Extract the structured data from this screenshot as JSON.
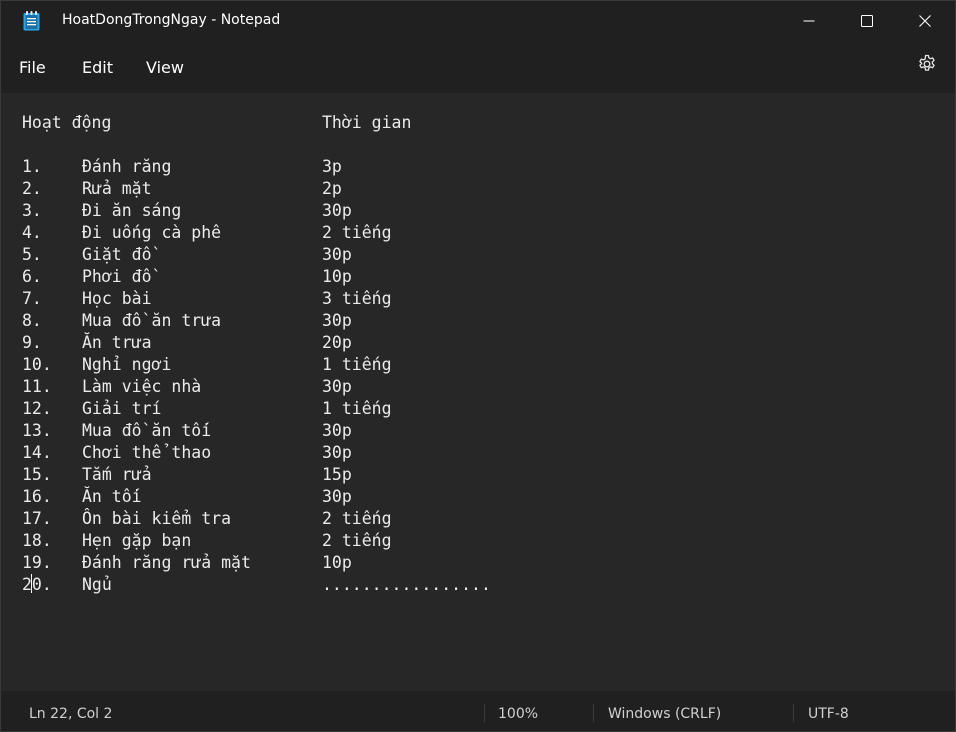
{
  "window": {
    "title": "HoatDongTrongNgay - Notepad"
  },
  "titlebar_controls": {
    "minimize_icon": "minimize-icon",
    "maximize_icon": "maximize-icon",
    "close_icon": "close-icon"
  },
  "menu": {
    "file": "File",
    "edit": "Edit",
    "view": "View",
    "settings_icon": "gear-icon"
  },
  "document": {
    "header": {
      "activity": "Hoạt động",
      "time": "Thời gian"
    },
    "rows": [
      {
        "num": "1.",
        "activity": "Đánh răng",
        "time": "3p"
      },
      {
        "num": "2.",
        "activity": "Rửa mặt",
        "time": "2p"
      },
      {
        "num": "3.",
        "activity": "Đi ăn sáng",
        "time": "30p"
      },
      {
        "num": "4.",
        "activity": "Đi uống cà phê",
        "time": "2 tiếng"
      },
      {
        "num": "5.",
        "activity": "Giặt đồ",
        "time": "30p"
      },
      {
        "num": "6.",
        "activity": "Phơi đồ",
        "time": "10p"
      },
      {
        "num": "7.",
        "activity": "Học bài",
        "time": "3 tiếng"
      },
      {
        "num": "8.",
        "activity": "Mua đồ ăn trưa",
        "time": "30p"
      },
      {
        "num": "9.",
        "activity": "Ăn trưa",
        "time": "20p"
      },
      {
        "num": "10.",
        "activity": "Nghỉ ngơi",
        "time": "1 tiếng"
      },
      {
        "num": "11.",
        "activity": "Làm việc nhà",
        "time": "30p"
      },
      {
        "num": "12.",
        "activity": "Giải trí",
        "time": "1 tiếng"
      },
      {
        "num": "13.",
        "activity": "Mua đồ ăn tối",
        "time": "30p"
      },
      {
        "num": "14.",
        "activity": "Chơi thể thao",
        "time": "30p"
      },
      {
        "num": "15.",
        "activity": "Tắm rửa",
        "time": "15p"
      },
      {
        "num": "16.",
        "activity": "Ăn tối",
        "time": "30p"
      },
      {
        "num": "17.",
        "activity": "Ôn bài kiểm tra",
        "time": "2 tiếng"
      },
      {
        "num": "18.",
        "activity": "Hẹn gặp bạn",
        "time": "2 tiếng"
      },
      {
        "num": "19.",
        "activity": "Đánh răng rửa mặt",
        "time": "10p"
      },
      {
        "num": "20.",
        "activity": "Ngủ",
        "time": "................."
      }
    ]
  },
  "statusbar": {
    "position": "Ln 22, Col 2",
    "zoom": "100%",
    "line_ending": "Windows (CRLF)",
    "encoding": "UTF-8"
  }
}
